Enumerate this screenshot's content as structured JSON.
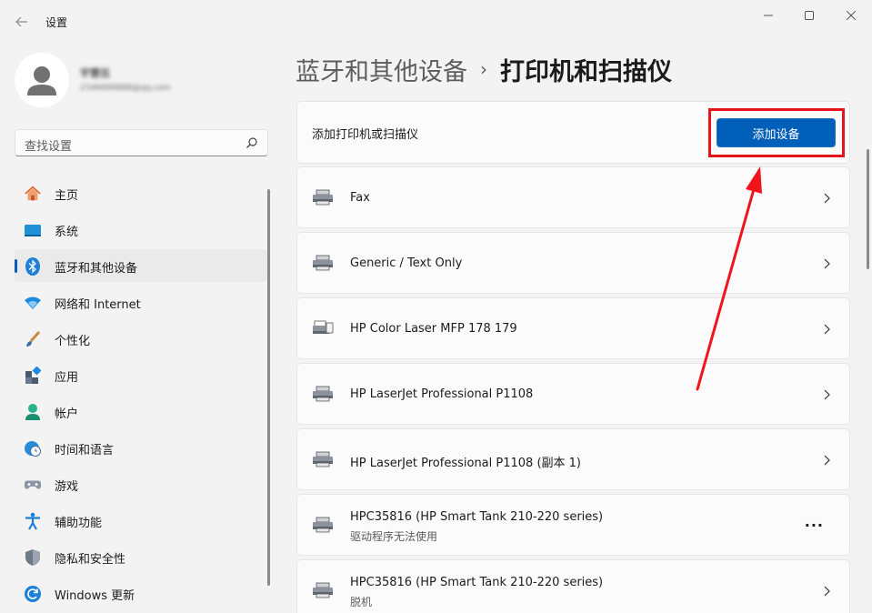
{
  "window": {
    "title": "设置",
    "controls": [
      "minimize-icon",
      "maximize-icon",
      "close-icon"
    ]
  },
  "profile": {
    "name": "宇慧伍",
    "email": "2349499888@qq.com"
  },
  "search": {
    "placeholder": "查找设置"
  },
  "sidebar": {
    "items": [
      {
        "label": "主页",
        "icon": "home-icon",
        "selected": false
      },
      {
        "label": "系统",
        "icon": "system-icon",
        "selected": false
      },
      {
        "label": "蓝牙和其他设备",
        "icon": "bluetooth-icon",
        "selected": true
      },
      {
        "label": "网络和 Internet",
        "icon": "wifi-icon",
        "selected": false
      },
      {
        "label": "个性化",
        "icon": "brush-icon",
        "selected": false
      },
      {
        "label": "应用",
        "icon": "apps-icon",
        "selected": false
      },
      {
        "label": "帐户",
        "icon": "account-icon",
        "selected": false
      },
      {
        "label": "时间和语言",
        "icon": "clock-globe-icon",
        "selected": false
      },
      {
        "label": "游戏",
        "icon": "gamepad-icon",
        "selected": false
      },
      {
        "label": "辅助功能",
        "icon": "accessibility-icon",
        "selected": false
      },
      {
        "label": "隐私和安全性",
        "icon": "shield-icon",
        "selected": false
      },
      {
        "label": "Windows 更新",
        "icon": "update-icon",
        "selected": false
      }
    ]
  },
  "breadcrumb": {
    "parent": "蓝牙和其他设备",
    "separator": "›",
    "current": "打印机和扫描仪"
  },
  "add_section": {
    "label": "添加打印机或扫描仪",
    "button": "添加设备"
  },
  "devices": [
    {
      "name": "Fax",
      "status": "",
      "action": "chevron"
    },
    {
      "name": "Generic / Text Only",
      "status": "",
      "action": "chevron"
    },
    {
      "name": "HP Color Laser MFP 178 179",
      "status": "",
      "action": "chevron"
    },
    {
      "name": "HP LaserJet Professional P1108",
      "status": "",
      "action": "chevron"
    },
    {
      "name": "HP LaserJet Professional P1108 (副本 1)",
      "status": "",
      "action": "chevron"
    },
    {
      "name": "HPC35816 (HP Smart Tank 210-220 series)",
      "status": "驱动程序无法使用",
      "action": "more"
    },
    {
      "name": "HPC35816 (HP Smart Tank 210-220 series)",
      "status": "脱机",
      "action": "chevron"
    }
  ],
  "more_glyph": "···",
  "colors": {
    "accent": "#005fb8",
    "highlight": "#e8141b",
    "background": "#f3f3f3",
    "card": "#fbfbfb"
  }
}
